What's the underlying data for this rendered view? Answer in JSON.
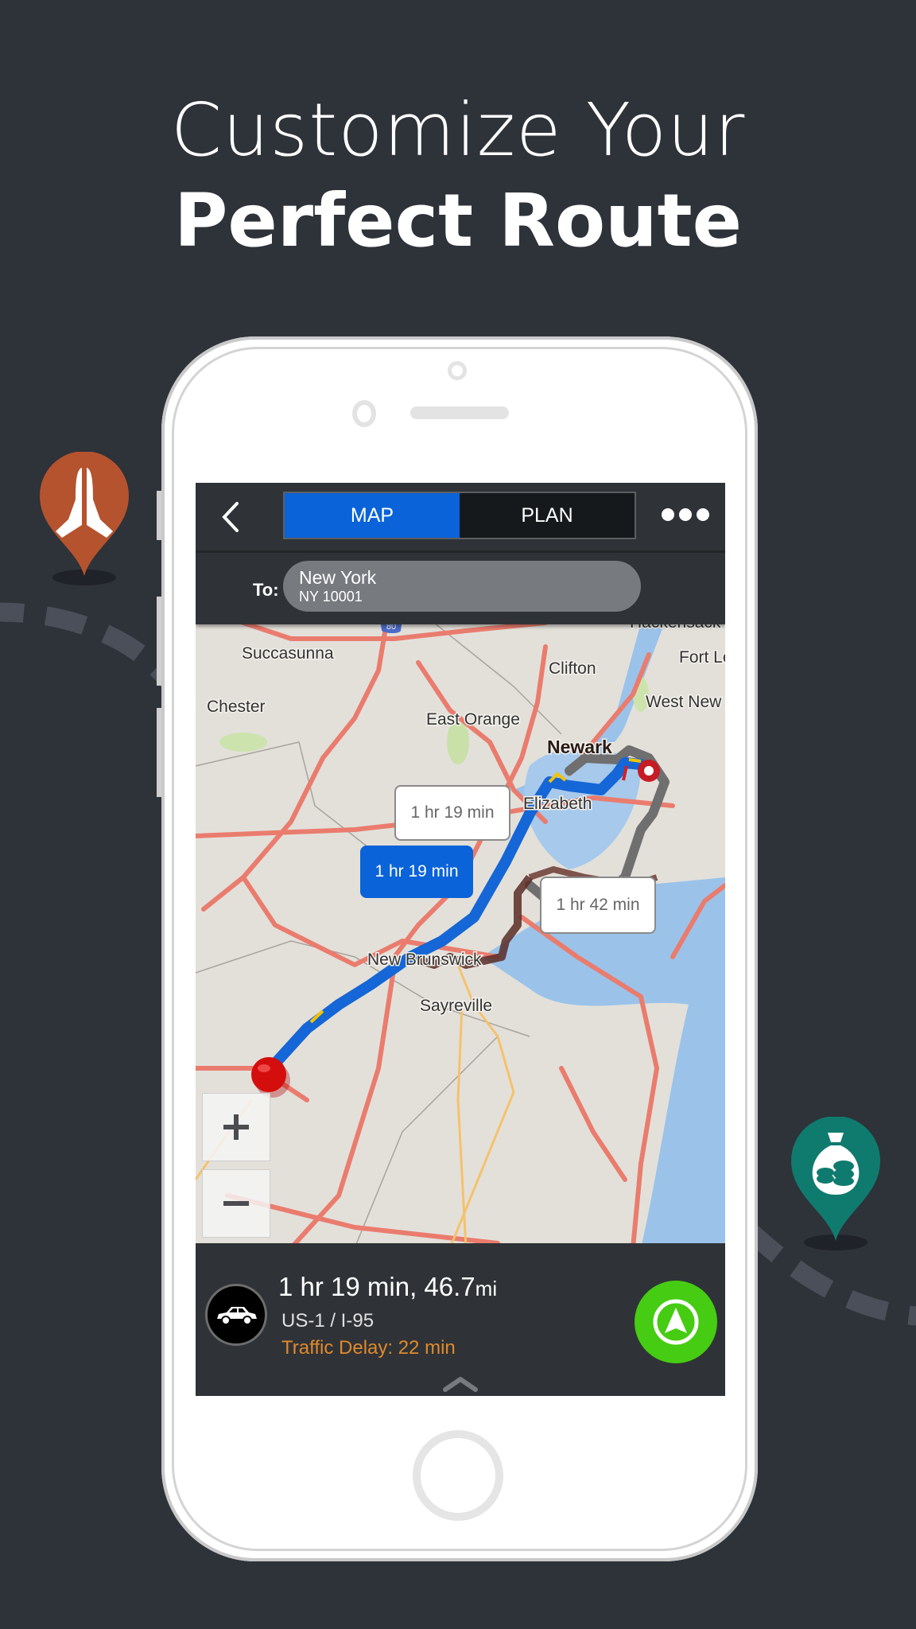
{
  "headline": {
    "line1": "Customize Your",
    "line2": "Perfect Route"
  },
  "decor": {
    "pin_left": {
      "icon": "praying-hands-icon",
      "color": "#b5532f"
    },
    "pin_right": {
      "icon": "money-bag-icon",
      "color": "#0f7b6e"
    }
  },
  "app": {
    "topbar": {
      "back_icon": "chevron-left-icon",
      "tabs": [
        {
          "label": "MAP",
          "active": true
        },
        {
          "label": "PLAN",
          "active": false
        }
      ],
      "more_icon": "more-dots-icon"
    },
    "destination": {
      "label": "To:",
      "city": "New York",
      "zip": "NY 10001"
    },
    "map": {
      "places": [
        "Succasunna",
        "Clifton",
        "Fort Le",
        "Chester",
        "East Orange",
        "West New",
        "Newark",
        "Elizabeth",
        "New Brunswick",
        "Sayreville",
        "Hackensack"
      ],
      "highway_shield": "80",
      "route_callouts": [
        {
          "label": "1 hr 19 min",
          "style": "white"
        },
        {
          "label": "1 hr 19 min",
          "style": "selected"
        },
        {
          "label": "1 hr 42 min",
          "style": "white"
        }
      ],
      "zoom_in": "+",
      "zoom_out": "−"
    },
    "route_summary": {
      "time_distance": "1 hr 19 min, 46.7",
      "unit": "mi",
      "roads": "US-1 / I-95",
      "traffic_delay": "Traffic Delay: 22 min",
      "mode_icon": "car-icon",
      "go_icon": "navigate-arrow-icon"
    },
    "colors": {
      "accent_blue": "#0a63d8",
      "go_green": "#46cc12",
      "delay_orange": "#e0892b"
    }
  }
}
